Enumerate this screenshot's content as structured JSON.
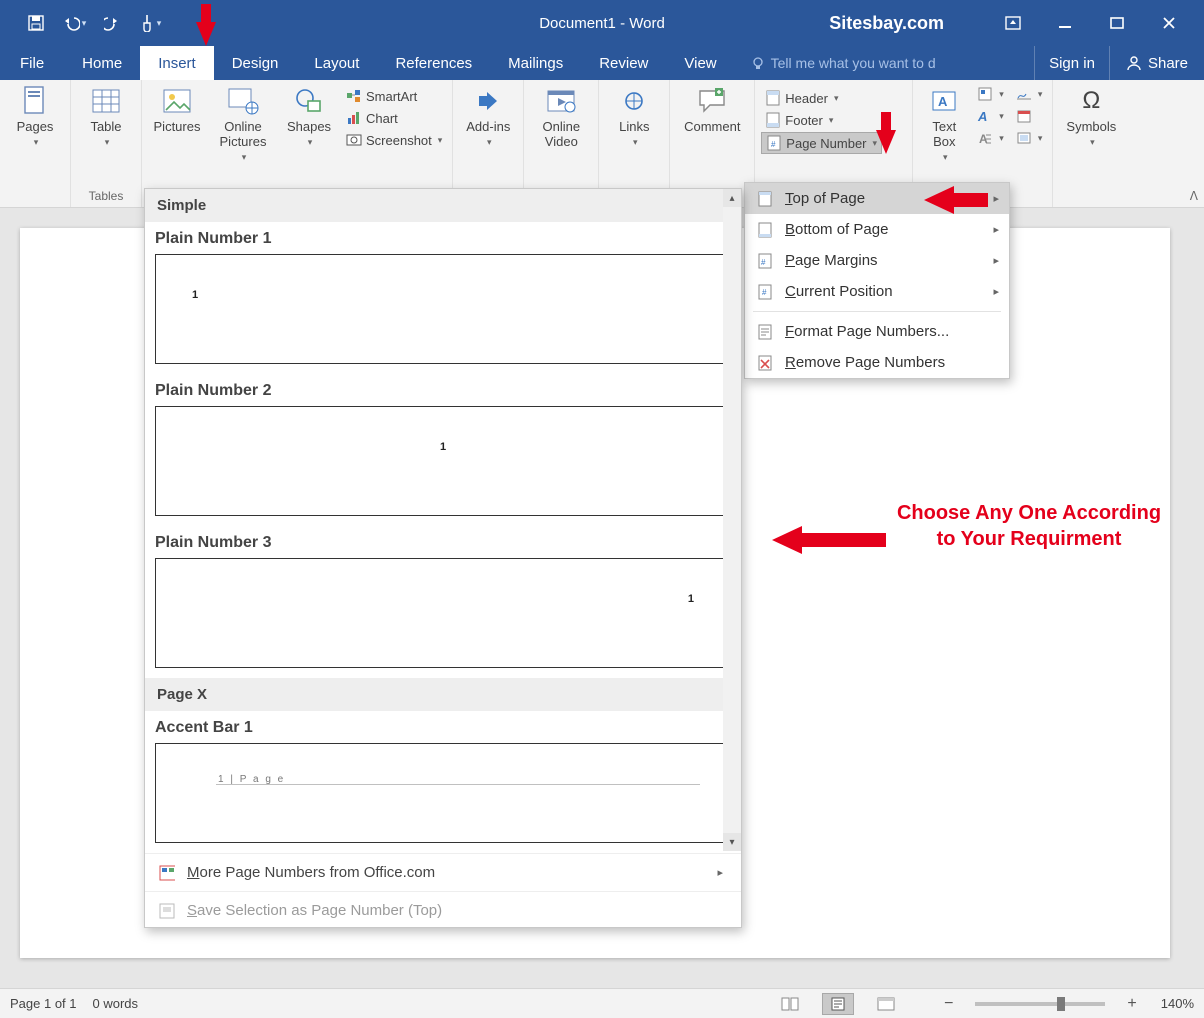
{
  "title_bar": {
    "doc_title": "Document1 - Word",
    "brand": "Sitesbay.com"
  },
  "tabs": {
    "file": "File",
    "home": "Home",
    "insert": "Insert",
    "design": "Design",
    "layout": "Layout",
    "references": "References",
    "mailings": "Mailings",
    "review": "Review",
    "view": "View",
    "tellme": "Tell me what you want to d",
    "signin": "Sign in",
    "share": "Share"
  },
  "ribbon": {
    "pages": {
      "btn": "Pages"
    },
    "tables": {
      "btn": "Table",
      "group": "Tables"
    },
    "illustrations": {
      "pictures": "Pictures",
      "online_pictures": "Online Pictures",
      "shapes": "Shapes",
      "smartart": "SmartArt",
      "chart": "Chart",
      "screenshot": "Screenshot"
    },
    "addins": {
      "btn": "Add-ins"
    },
    "media": {
      "btn": "Online Video"
    },
    "links": {
      "btn": "Links"
    },
    "comments": {
      "btn": "Comment"
    },
    "headerfooter": {
      "header": "Header",
      "footer": "Footer",
      "page_number": "Page Number"
    },
    "text": {
      "btn": "Text Box"
    },
    "symbols": {
      "btn": "Symbols"
    }
  },
  "page_number_menu": {
    "top": "Top of Page",
    "bottom": "Bottom of Page",
    "margins": "Page Margins",
    "current": "Current Position",
    "format": "Format Page Numbers...",
    "remove": "Remove Page Numbers"
  },
  "gallery": {
    "section_simple": "Simple",
    "pn1": "Plain Number 1",
    "pn2": "Plain Number 2",
    "pn3": "Plain Number 3",
    "section_pagex": "Page X",
    "ab1": "Accent Bar 1",
    "accent_text": "1 | P a g e",
    "more": "More Page Numbers from Office.com",
    "save_sel": "Save Selection as Page Number (Top)"
  },
  "annotation": {
    "text_l1": "Choose Any One According",
    "text_l2": "to Your Requirment"
  },
  "status": {
    "page": "Page 1 of 1",
    "words": "0 words",
    "zoom": "140%"
  }
}
